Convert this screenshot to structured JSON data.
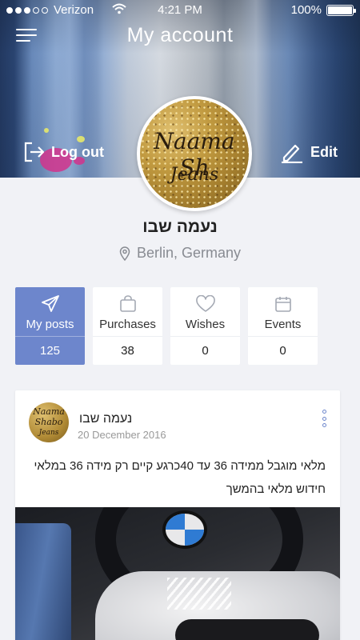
{
  "status_bar": {
    "carrier": "Verizon",
    "signal_dots_filled": 3,
    "signal_dots_total": 5,
    "time": "4:21 PM",
    "battery": "100%"
  },
  "header": {
    "title": "My account",
    "logout_label": "Log out",
    "edit_label": "Edit",
    "icons": {
      "menu": "hamburger-menu-icon",
      "logout": "logout-icon",
      "edit": "pencil-icon"
    }
  },
  "avatar": {
    "brand_line1": "Naama Sh",
    "brand_line2": "Jeans"
  },
  "profile": {
    "name": "נעמה שבו",
    "location": "Berlin, Germany",
    "location_icon": "map-pin-icon"
  },
  "stats": [
    {
      "label": "My posts",
      "value": "125",
      "icon": "send-icon",
      "active": true
    },
    {
      "label": "Purchases",
      "value": "38",
      "icon": "shopping-bag-icon",
      "active": false
    },
    {
      "label": "Wishes",
      "value": "0",
      "icon": "heart-icon",
      "active": false
    },
    {
      "label": "Events",
      "value": "0",
      "icon": "calendar-icon",
      "active": false
    }
  ],
  "post": {
    "avatar_text": [
      "Naama",
      "Shabo",
      "Jeans"
    ],
    "author": "נעמה שבו",
    "date": "20 December 2016",
    "text_line1": "מלאי מוגבל ממידה 36 עד 40כרגע קיים רק מידה 36 במלאי",
    "text_line2": "חידוש מלאי בהמשך",
    "menu_icon": "more-vertical-icon"
  },
  "colors": {
    "accent": "#6d86cc",
    "background": "#f1f2f6",
    "text_muted": "#888b92"
  }
}
